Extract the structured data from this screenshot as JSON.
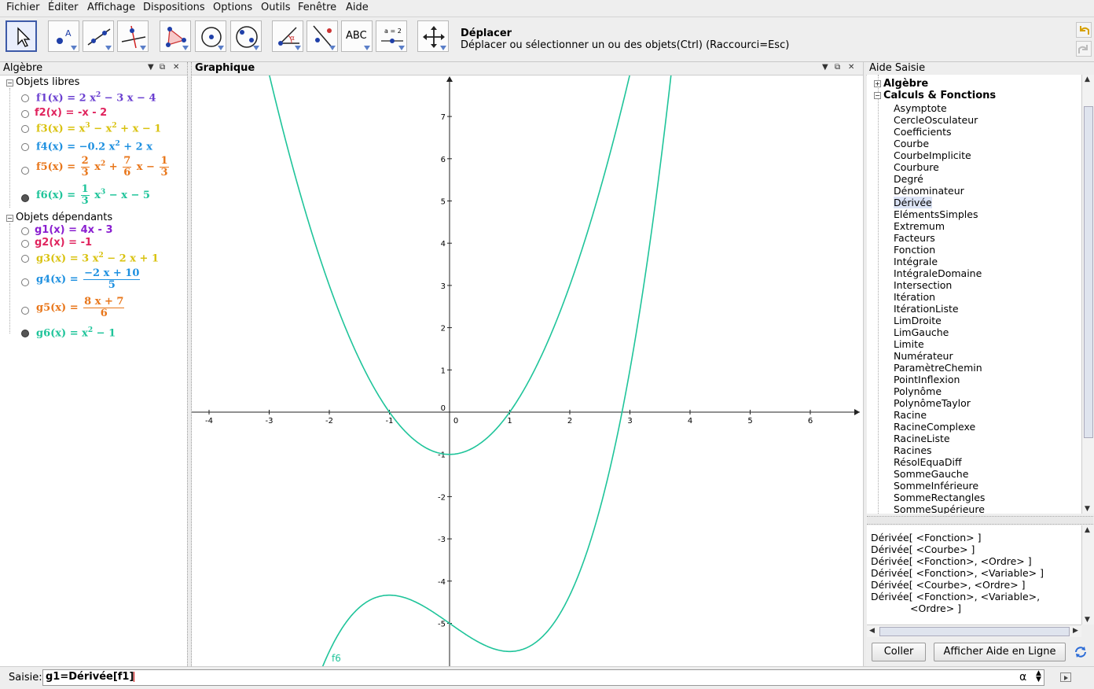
{
  "menu": [
    "Fichier",
    "Éditer",
    "Affichage",
    "Dispositions",
    "Options",
    "Outils",
    "Fenêtre",
    "Aide"
  ],
  "toolbar": {
    "active_tool_title": "Déplacer",
    "active_tool_description": "Déplacer ou sélectionner un ou des objets(Ctrl) (Raccourci=Esc)",
    "text_tool_label": "ABC",
    "slider_tool_label": "a = 2"
  },
  "algebra": {
    "title": "Algèbre",
    "free_header": "Objets libres",
    "dependent_header": "Objets dépendants",
    "free": [
      {
        "name": "f1(x)",
        "expr": "2 x² − 3 x − 4",
        "color": "#6a3fd0",
        "shown": false
      },
      {
        "name": "f2(x)",
        "expr": "-x - 2",
        "color": "#e0245e",
        "shown": false
      },
      {
        "name": "f3(x)",
        "expr": "x³ − x² + x − 1",
        "color": "#d9c20f",
        "shown": false
      },
      {
        "name": "f4(x)",
        "expr": "−0.2 x² + 2 x",
        "color": "#1e90e0",
        "shown": false
      },
      {
        "name": "f5(x)",
        "expr": "2/3 x² + 7/6 x − 1/3",
        "color": "#e8761a",
        "shown": false
      },
      {
        "name": "f6(x)",
        "expr": "1/3 x³ − x − 5",
        "color": "#1fc49a",
        "shown": true
      }
    ],
    "dependent": [
      {
        "name": "g1(x)",
        "expr": "4x - 3",
        "color": "#8a1fd0",
        "shown": false
      },
      {
        "name": "g2(x)",
        "expr": "-1",
        "color": "#e0245e",
        "shown": false
      },
      {
        "name": "g3(x)",
        "expr": "3 x² − 2 x + 1",
        "color": "#d9c20f",
        "shown": false
      },
      {
        "name": "g4(x)",
        "expr": "(−2 x + 10) / 5",
        "color": "#1e90e0",
        "shown": false
      },
      {
        "name": "g5(x)",
        "expr": "(8 x + 7) / 6",
        "color": "#e8761a",
        "shown": false
      },
      {
        "name": "g6(x)",
        "expr": "x² − 1",
        "color": "#1fc49a",
        "shown": true
      }
    ]
  },
  "graphics": {
    "title": "Graphique",
    "curve_label": "f6",
    "curve_color": "#1fc49a",
    "x_ticks": [
      "-4",
      "-3",
      "-2",
      "-1",
      "0",
      "1",
      "2",
      "3",
      "4",
      "5",
      "6"
    ],
    "y_ticks": [
      "7",
      "6",
      "5",
      "4",
      "3",
      "2",
      "1",
      "0",
      "-1",
      "-2",
      "-3",
      "-4",
      "-5"
    ]
  },
  "chart_data": {
    "type": "line",
    "title": "",
    "xlim": [
      -4.3,
      6.8
    ],
    "ylim": [
      -5.9,
      8
    ],
    "series": [
      {
        "name": "f6",
        "function": "x^3/3 - x - 5",
        "color": "#1fc49a"
      },
      {
        "name": "g6",
        "function": "x^2 - 1",
        "color": "#1fc49a"
      }
    ]
  },
  "help": {
    "title": "Aide Saisie",
    "category_algebra": "Algèbre",
    "category_calculs": "Calculs & Fonctions",
    "commands": [
      "Asymptote",
      "CercleOsculateur",
      "Coefficients",
      "Courbe",
      "CourbeImplicite",
      "Courbure",
      "Degré",
      "Dénominateur",
      "Dérivée",
      "ElémentsSimples",
      "Extremum",
      "Facteurs",
      "Fonction",
      "Intégrale",
      "IntégraleDomaine",
      "Intersection",
      "Itération",
      "ItérationListe",
      "LimDroite",
      "LimGauche",
      "Limite",
      "Numérateur",
      "ParamètreChemin",
      "PointInflexion",
      "Polynôme",
      "PolynômeTaylor",
      "Racine",
      "RacineComplexe",
      "RacineListe",
      "Racines",
      "RésolEquaDiff",
      "SommeGauche",
      "SommeInférieure",
      "SommeRectangles",
      "SommeSupérieure"
    ],
    "selected_command": "Dérivée",
    "syntax": [
      "Dérivée[ <Fonction> ]",
      "Dérivée[ <Courbe> ]",
      "Dérivée[ <Fonction>, <Ordre> ]",
      "Dérivée[ <Fonction>, <Variable> ]",
      "Dérivée[ <Courbe>, <Ordre> ]",
      "Dérivée[ <Fonction>, <Variable>,",
      "<Ordre> ]"
    ],
    "paste_button": "Coller",
    "online_help_button": "Afficher Aide en Ligne"
  },
  "input": {
    "label": "Saisie:",
    "value": "g1=Dérivée[f1]",
    "alpha": "α"
  }
}
